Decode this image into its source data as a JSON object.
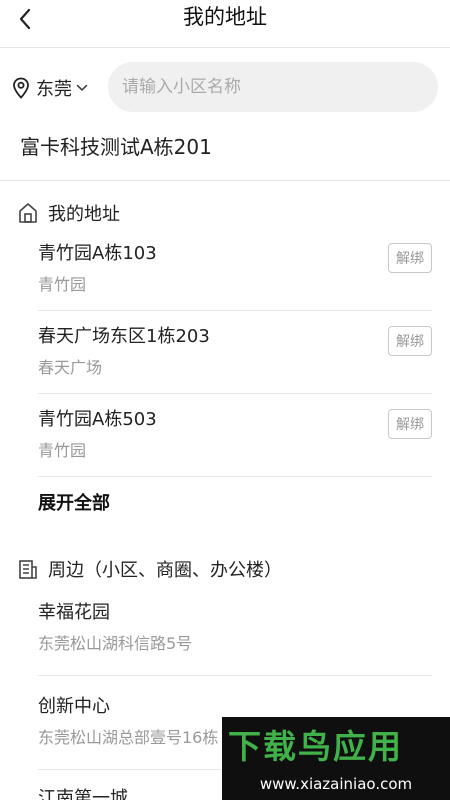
{
  "header": {
    "title": "我的地址"
  },
  "search": {
    "city": "东莞",
    "placeholder": "请输入小区名称"
  },
  "current_address": "富卡科技测试A栋201",
  "my_addresses": {
    "title": "我的地址",
    "items": [
      {
        "name": "青竹园A栋103",
        "community": "青竹园",
        "unbind_label": "解绑"
      },
      {
        "name": "春天广场东区1栋203",
        "community": "春天广场",
        "unbind_label": "解绑"
      },
      {
        "name": "青竹园A栋503",
        "community": "青竹园",
        "unbind_label": "解绑"
      }
    ],
    "expand_label": "展开全部"
  },
  "nearby": {
    "title": "周边（小区、商圈、办公楼）",
    "items": [
      {
        "name": "幸福花园",
        "address": "东莞松山湖科信路5号"
      },
      {
        "name": "创新中心",
        "address": "东莞松山湖总部壹号16栋"
      },
      {
        "name": "江南第一城",
        "address": ""
      }
    ]
  },
  "watermark": {
    "title": "下载鸟应用",
    "url": "www.xiazainiao.com"
  }
}
